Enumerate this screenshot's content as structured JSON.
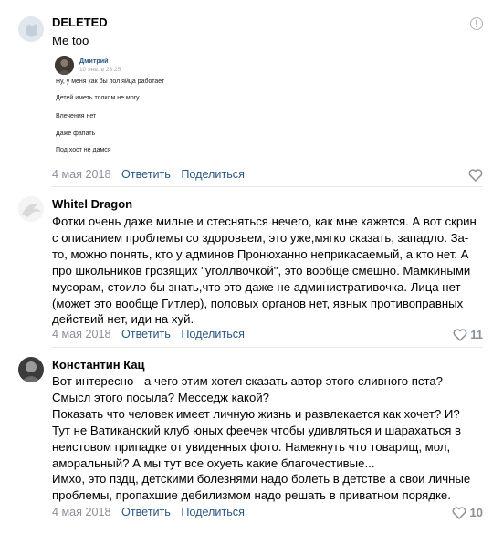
{
  "comments": [
    {
      "author": "DELETED",
      "text_lines": [
        "Me too"
      ],
      "quote": {
        "author": "Дмитрий",
        "time": "10 янв. в 23:25",
        "lines": [
          "Ну, у меня как бы пол яйца работает",
          "Детей иметь толком не могу",
          "Влечения нет",
          "Даже фапать",
          "Под хост не дамся"
        ]
      },
      "date": "4 мая 2018",
      "reply_label": "Ответить",
      "share_label": "Поделиться",
      "likes": ""
    },
    {
      "author": "Whitel Dragon",
      "text_lines": [
        "Фотки очень даже милые и стесняться нечего, как мне кажется. А вот скрин",
        "с описанием проблемы со здоровьем, это уже,мягко сказать, западло. За-",
        "то, можно понять, кто у админов Пронюханно неприкасаемый, а кто нет. А",
        "про школьников грозящих \"уголлвочкой\", это вообще смешно. Мамкиными",
        "мусорам, стоило бы знать,что это даже не административочка. Лица нет",
        "(может это вообще Гитлер), половых органов нет, явных противоправных",
        "действий нет, иди на хуй."
      ],
      "date": "4 мая 2018",
      "reply_label": "Ответить",
      "share_label": "Поделиться",
      "likes": "11"
    },
    {
      "author": "Константин Кац",
      "text_lines": [
        "Вот интересно - а чего этим хотел сказать автор этого сливного пста?",
        "Смысл этого посыла? Месседж какой?",
        "Показать что человек имеет личную жизнь и развлекается как хочет? И?",
        "Тут не Ватиканский клуб юных феечек чтобы удивляться и шарахаться в",
        "неистовом припадке от увиденных фото. Намекнуть что товарищ, мол,",
        "аморальный? А мы тут все охуеть какие благочестивые...",
        "Имхо, это пздц, детскими болезнями надо болеть в детстве а свои личные",
        "проблемы, пропахшие дебилизмом надо решать в приватном порядке."
      ],
      "date": "4 мая 2018",
      "reply_label": "Ответить",
      "share_label": "Поделиться",
      "likes": "10"
    }
  ]
}
